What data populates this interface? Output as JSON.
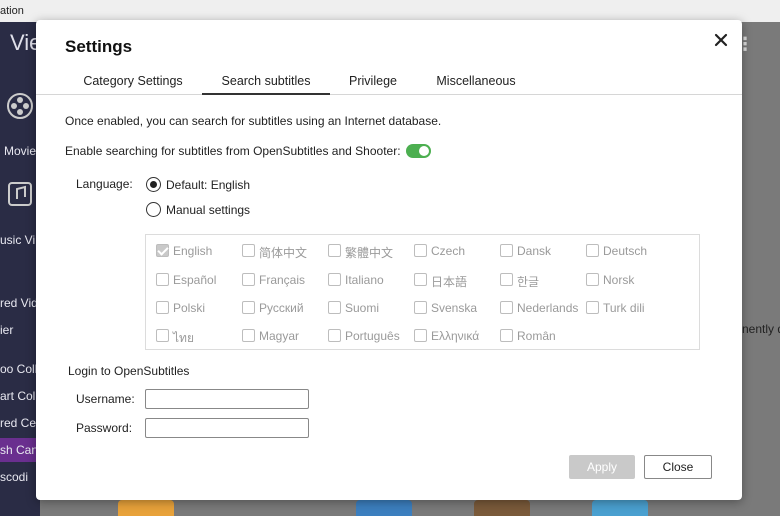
{
  "background": {
    "window_title": "ation",
    "app_title": "Vie",
    "sidebar_items": [
      "Movie",
      "usic Vi",
      "red Vid",
      "ier",
      "oo Colle",
      "art Colle",
      "red Ce",
      "sh Can",
      "scodi"
    ],
    "right_text": "nently d",
    "colors": {
      "sidebar": "#2a2c45",
      "active": "#6a2f8f"
    }
  },
  "dialog": {
    "title": "Settings",
    "tabs": [
      {
        "label": "Category Settings",
        "active": false
      },
      {
        "label": "Search subtitles",
        "active": true
      },
      {
        "label": "Privilege",
        "active": false
      },
      {
        "label": "Miscellaneous",
        "active": false
      }
    ],
    "description": "Once enabled, you can search for subtitles using an Internet database.",
    "enable_label": "Enable searching for subtitles from OpenSubtitles and Shooter:",
    "enable_on": true,
    "language": {
      "label": "Language:",
      "default_option": "Default: English",
      "manual_option": "Manual settings",
      "selected": "default"
    },
    "languages": [
      {
        "label": "English",
        "checked": true
      },
      {
        "label": "简体中文",
        "checked": false
      },
      {
        "label": "繁體中文",
        "checked": false
      },
      {
        "label": "Czech",
        "checked": false
      },
      {
        "label": "Dansk",
        "checked": false
      },
      {
        "label": "Deutsch",
        "checked": false
      },
      {
        "label": "Español",
        "checked": false
      },
      {
        "label": "Français",
        "checked": false
      },
      {
        "label": "Italiano",
        "checked": false
      },
      {
        "label": "日本語",
        "checked": false
      },
      {
        "label": "한글",
        "checked": false
      },
      {
        "label": "Norsk",
        "checked": false
      },
      {
        "label": "Polski",
        "checked": false
      },
      {
        "label": "Русский",
        "checked": false
      },
      {
        "label": "Suomi",
        "checked": false
      },
      {
        "label": "Svenska",
        "checked": false
      },
      {
        "label": "Nederlands",
        "checked": false
      },
      {
        "label": "Turk dili",
        "checked": false
      },
      {
        "label": "ไทย",
        "checked": false
      },
      {
        "label": "Magyar",
        "checked": false
      },
      {
        "label": "Português",
        "checked": false
      },
      {
        "label": "Ελληνικά",
        "checked": false
      },
      {
        "label": "Român",
        "checked": false
      }
    ],
    "login": {
      "title": "Login to OpenSubtitles",
      "username_label": "Username:",
      "username_value": "",
      "password_label": "Password:",
      "password_value": ""
    },
    "buttons": {
      "apply": "Apply",
      "close": "Close"
    },
    "colors": {
      "toggle_on": "#4caf50",
      "disabled_button": "#c9c9c9"
    }
  }
}
